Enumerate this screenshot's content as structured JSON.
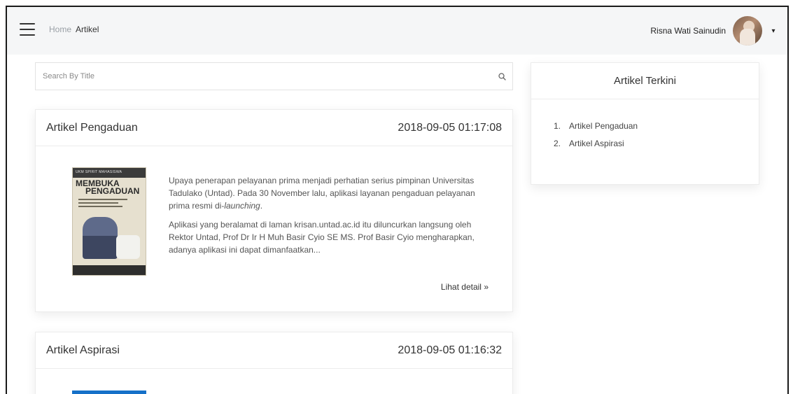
{
  "navbar": {
    "menu_icon": "hamburger-icon",
    "breadcrumb": {
      "home": "Home",
      "current": "Artikel"
    },
    "user": {
      "name": "Risna Wati Sainudin",
      "dropdown_icon": "caret-down-icon"
    }
  },
  "search": {
    "placeholder": "Search By Title",
    "icon": "search-icon"
  },
  "articles": [
    {
      "title": "Artikel Pengaduan",
      "date": "2018-09-05 01:17:08",
      "thumbnail": {
        "header_text": "UKM SPIRIT MAHASISWA",
        "line1": "MEMBUKA",
        "line2": "PENGADUAN"
      },
      "paragraph1_pre": "Upaya penerapan pelayanan prima menjadi perhatian serius pimpinan Universitas Tadulako (Untad). Pada 30 November lalu, aplikasi layanan pengaduan pelayanan prima resmi di-",
      "paragraph1_em": "launching",
      "paragraph1_post": ".",
      "paragraph2": "Aplikasi yang beralamat di laman krisan.untad.ac.id itu diluncurkan langsung oleh Rektor Untad, Prof Dr Ir H Muh Basir Cyio SE MS. Prof Basir Cyio mengharapkan, adanya aplikasi ini dapat dimanfaatkan...",
      "detail_link": "Lihat detail",
      "detail_icon": "double-chevron-right-icon"
    },
    {
      "title": "Artikel Aspirasi",
      "date": "2018-09-05 01:16:32"
    }
  ],
  "sidebar": {
    "title": "Artikel Terkini",
    "items": [
      {
        "num": "1.",
        "label": "Artikel Pengaduan"
      },
      {
        "num": "2.",
        "label": "Artikel Aspirasi"
      }
    ]
  },
  "colors": {
    "navbar_bg": "#f5f6f7",
    "card2_thumbnail": "#1570c8",
    "frame_border": "#1a1a1a"
  }
}
